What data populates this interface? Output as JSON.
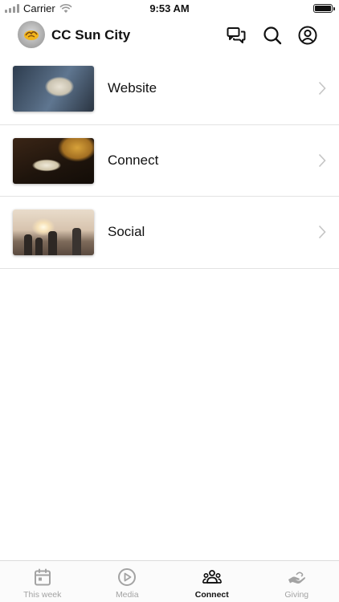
{
  "status_bar": {
    "carrier": "Carrier",
    "time": "9:53 AM"
  },
  "header": {
    "title": "CC Sun City"
  },
  "items": [
    {
      "label": "Website"
    },
    {
      "label": "Connect"
    },
    {
      "label": "Social"
    }
  ],
  "tabs": [
    {
      "label": "This week",
      "icon": "calendar-icon",
      "active": false
    },
    {
      "label": "Media",
      "icon": "play-circle-icon",
      "active": false
    },
    {
      "label": "Connect",
      "icon": "people-icon",
      "active": true
    },
    {
      "label": "Giving",
      "icon": "giving-hand-icon",
      "active": false
    }
  ],
  "colors": {
    "active_tab": "#111111",
    "inactive_tab": "#a3a3a3",
    "divider": "#e2e2e2"
  }
}
